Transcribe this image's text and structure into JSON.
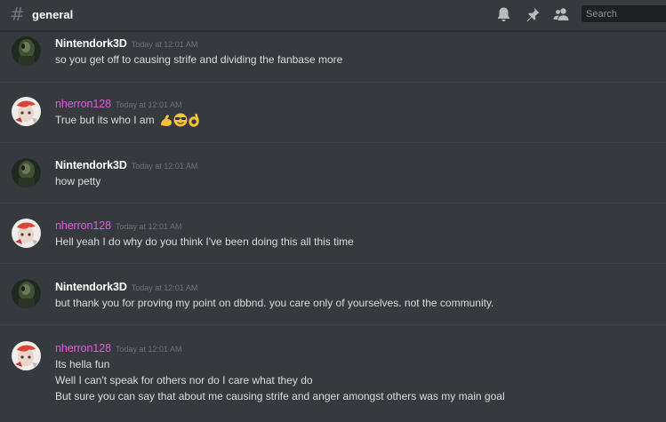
{
  "header": {
    "hash_symbol": "#",
    "channel": "general",
    "search_placeholder": "Search",
    "icons": [
      "bell-icon",
      "pin-icon",
      "members-icon"
    ]
  },
  "colors": {
    "background": "#36393e",
    "username_nintendork": "#ffffff",
    "username_nherron": "#e15ee1",
    "text": "#dcddde",
    "timestamp": "#6f7378"
  },
  "messages": [
    {
      "author": "Nintendork3D",
      "timestamp": "Today at 12:01 AM",
      "lines": [
        "so you get off to causing strife and dividing the fanbase more"
      ]
    },
    {
      "author": "nherron128",
      "timestamp": "Today at 12:01 AM",
      "lines": [
        "True but its who I am"
      ],
      "emoji": [
        "flexed-biceps",
        "smiling-face-with-sunglasses",
        "ok-hand"
      ]
    },
    {
      "author": "Nintendork3D",
      "timestamp": "Today at 12:01 AM",
      "lines": [
        "how petty"
      ]
    },
    {
      "author": "nherron128",
      "timestamp": "Today at 12:01 AM",
      "lines": [
        "Hell yeah I do why do you think I've been doing this all this time"
      ]
    },
    {
      "author": "Nintendork3D",
      "timestamp": "Today at 12:01 AM",
      "lines": [
        "but thank you for proving my point on dbbnd.  you care only of yourselves.  not the community."
      ]
    },
    {
      "author": "nherron128",
      "timestamp": "Today at 12:01 AM",
      "lines": [
        "Its hella fun",
        "Well I can't speak for others nor do I care what they do",
        "But sure you can say that about me causing strife and anger amongst others was my main goal"
      ]
    }
  ]
}
